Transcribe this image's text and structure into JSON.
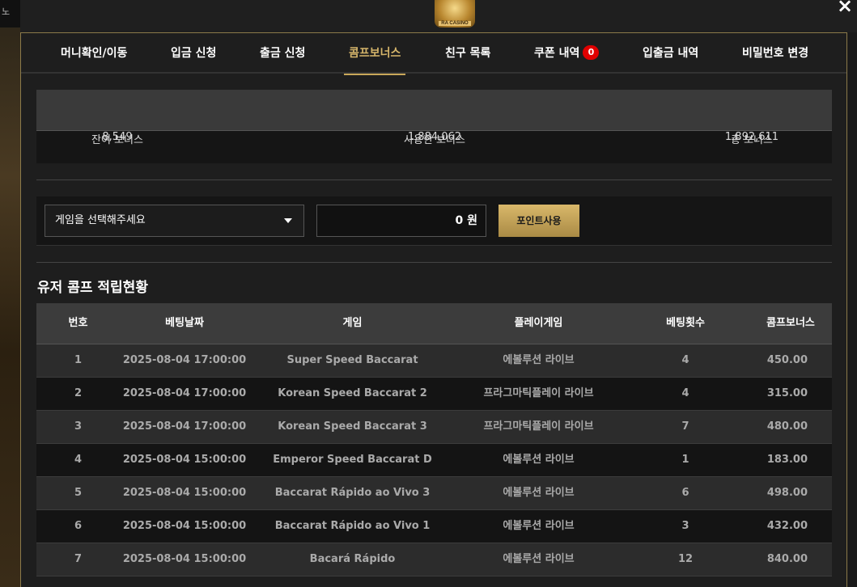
{
  "side_tag": "노",
  "logo_text": "RA CASINO",
  "tabs": [
    {
      "label": "머니확인/이동"
    },
    {
      "label": "입금 신청"
    },
    {
      "label": "출금 신청"
    },
    {
      "label": "콤프보너스"
    },
    {
      "label": "친구 목록"
    },
    {
      "label": "쿠폰 내역",
      "badge": "0"
    },
    {
      "label": "입출금 내역"
    },
    {
      "label": "비밀번호 변경"
    }
  ],
  "summary": {
    "headers": [
      "잔여 보너스",
      "사용한 보너스",
      "총 보너스"
    ],
    "values": [
      "8,549",
      "1,884,062",
      "1,892,611"
    ]
  },
  "points": {
    "select_text": "게임을 선택해주세요",
    "amount": "0 원",
    "button": "포인트사용"
  },
  "section_title": "유저 콤프 적립현황",
  "table": {
    "headers": [
      "번호",
      "베팅날짜",
      "게임",
      "플레이게임",
      "베팅횟수",
      "콤프보너스"
    ],
    "rows": [
      [
        "1",
        "2025-08-04 17:00:00",
        "Super Speed Baccarat",
        "에볼루션 라이브",
        "4",
        "450.00"
      ],
      [
        "2",
        "2025-08-04 17:00:00",
        "Korean Speed Baccarat 2",
        "프라그마틱플레이 라이브",
        "4",
        "315.00"
      ],
      [
        "3",
        "2025-08-04 17:00:00",
        "Korean Speed Baccarat 3",
        "프라그마틱플레이 라이브",
        "7",
        "480.00"
      ],
      [
        "4",
        "2025-08-04 15:00:00",
        "Emperor Speed Baccarat D",
        "에볼루션 라이브",
        "1",
        "183.00"
      ],
      [
        "5",
        "2025-08-04 15:00:00",
        "Baccarat Rápido ao Vivo 3",
        "에볼루션 라이브",
        "6",
        "498.00"
      ],
      [
        "6",
        "2025-08-04 15:00:00",
        "Baccarat Rápido ao Vivo 1",
        "에볼루션 라이브",
        "3",
        "432.00"
      ],
      [
        "7",
        "2025-08-04 15:00:00",
        "Bacará Rápido",
        "에볼루션 라이브",
        "12",
        "840.00"
      ]
    ]
  },
  "colors": {
    "accent_gold": "#c9a85a",
    "badge_red": "#e00000"
  }
}
